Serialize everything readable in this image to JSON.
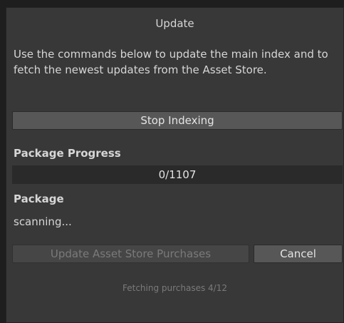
{
  "dialog": {
    "title": "Update",
    "description": "Use the commands below to update the main index and to fetch the newest updates from the Asset Store.",
    "stop_button": "Stop Indexing",
    "progress_label": "Package Progress",
    "progress_text": "0/1107",
    "progress_fraction": 0,
    "package_label": "Package",
    "package_status": "scanning...",
    "update_button": "Update Asset Store Purchases",
    "cancel_button": "Cancel",
    "fetching_status": "Fetching purchases 4/12"
  }
}
